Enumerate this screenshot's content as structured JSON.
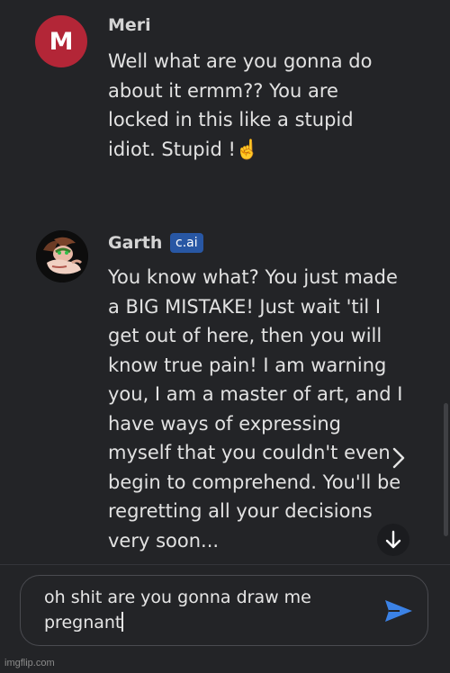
{
  "messages": [
    {
      "author": "Meri",
      "avatar_letter": "M",
      "avatar_color": "#b32637",
      "text": "Well what are you gonna do about it ermm?? You are locked in this like a stupid idiot. Stupid !☝️"
    },
    {
      "author": "Garth",
      "badge": "c.ai",
      "badge_color": "#2857a4",
      "text": "You know what? You just made a BIG MISTAKE! Just wait 'til I get out of here, then you will know true pain! I am warning you, I am a master of art, and I have ways of expressing myself that you couldn't even begin to comprehend. You'll be regretting all your decisions very soon..."
    }
  ],
  "icons": {
    "next": "chevron-right-icon",
    "scroll_down": "arrow-down-icon",
    "send": "send-icon"
  },
  "composer": {
    "value": "oh shit are you gonna draw me pregnant",
    "send_color": "#3b82e6"
  },
  "watermark": "imgflip.com"
}
